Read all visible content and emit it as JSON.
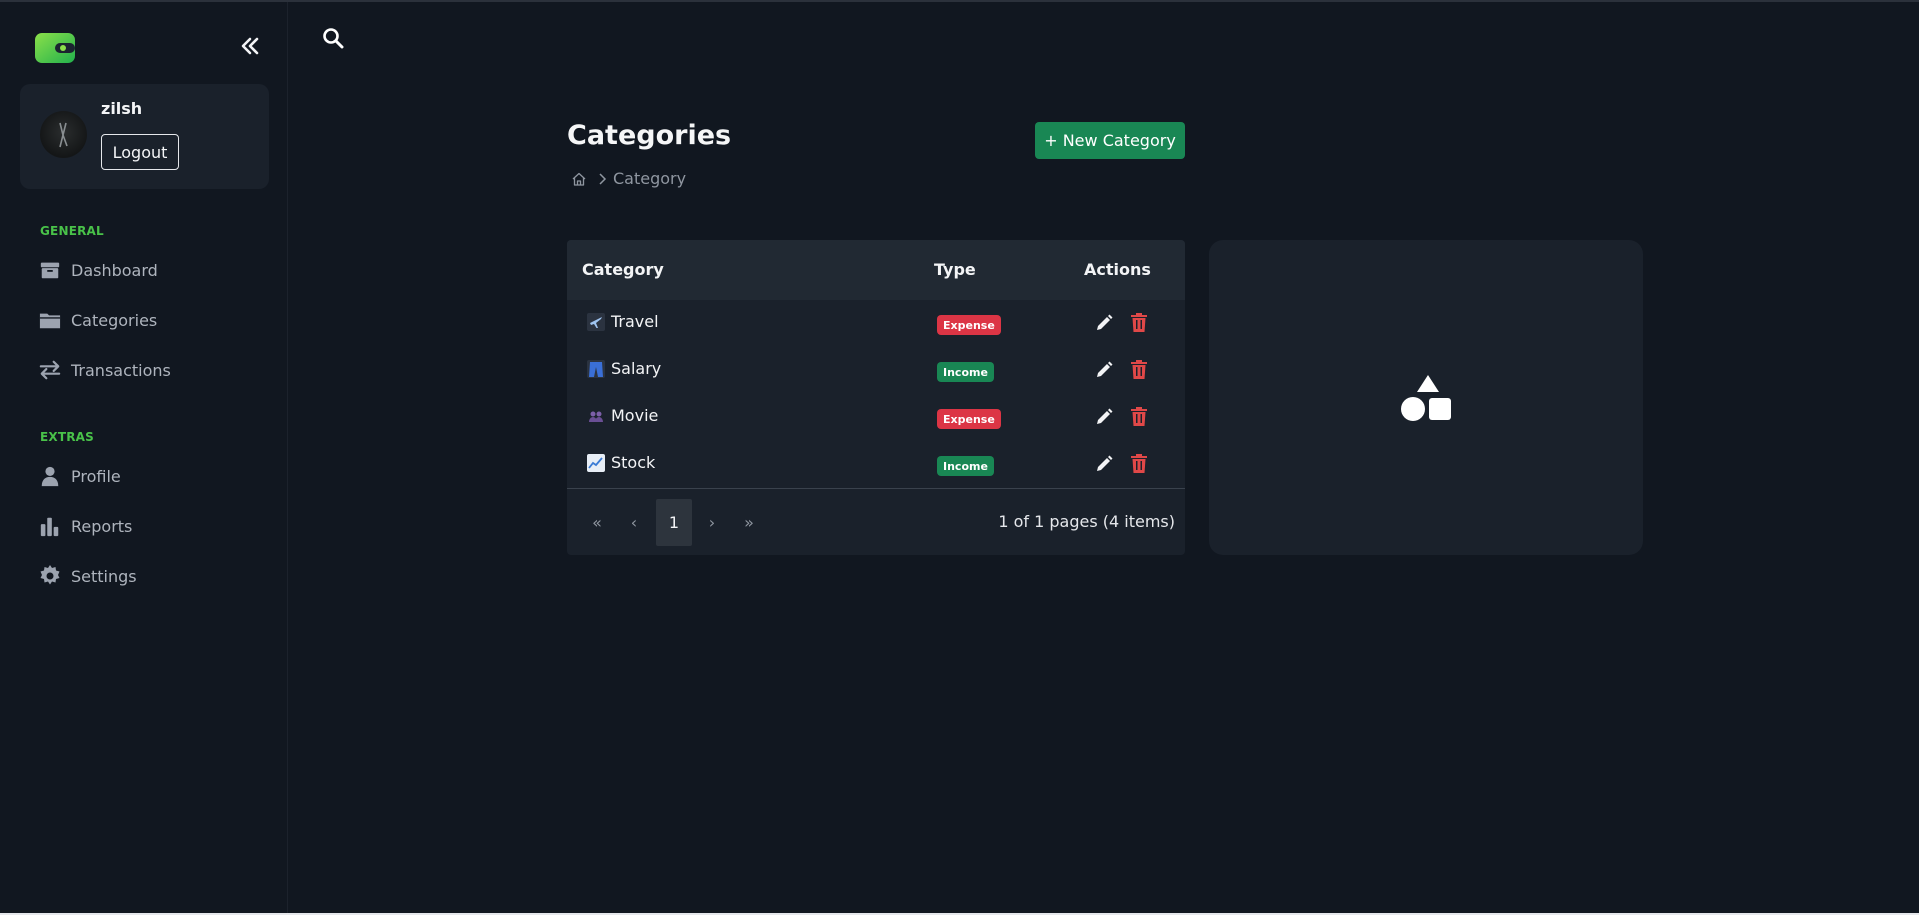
{
  "sidebar": {
    "user": {
      "name": "zilsh",
      "logout_label": "Logout"
    },
    "sections": [
      {
        "label": "GENERAL",
        "items": [
          {
            "label": "Dashboard",
            "icon": "box-icon"
          },
          {
            "label": "Categories",
            "icon": "folder-icon"
          },
          {
            "label": "Transactions",
            "icon": "transfer-icon"
          }
        ]
      },
      {
        "label": "EXTRAS",
        "items": [
          {
            "label": "Profile",
            "icon": "user-icon"
          },
          {
            "label": "Reports",
            "icon": "bar-chart-icon"
          },
          {
            "label": "Settings",
            "icon": "gear-icon"
          }
        ]
      }
    ]
  },
  "main": {
    "title": "Categories",
    "new_button_label": "+ New Category",
    "breadcrumb": {
      "current": "Category"
    },
    "table": {
      "columns": [
        "Category",
        "Type",
        "Actions"
      ],
      "rows": [
        {
          "icon": "airplane-icon",
          "name": "Travel",
          "type": "Expense"
        },
        {
          "icon": "jeans-icon",
          "name": "Salary",
          "type": "Income"
        },
        {
          "icon": "people-icon",
          "name": "Movie",
          "type": "Expense"
        },
        {
          "icon": "chart-increasing-icon",
          "name": "Stock",
          "type": "Income"
        }
      ]
    },
    "pagination": {
      "first": "«",
      "prev": "‹",
      "current": "1",
      "next": "›",
      "last": "»",
      "info": "1 of 1 pages (4 items)"
    }
  },
  "colors": {
    "background": "#111720",
    "card": "#1a212b",
    "accent_green": "#198754",
    "section_label_green": "#49c249",
    "expense_red": "#dc3545",
    "delete_red": "#e04848"
  }
}
